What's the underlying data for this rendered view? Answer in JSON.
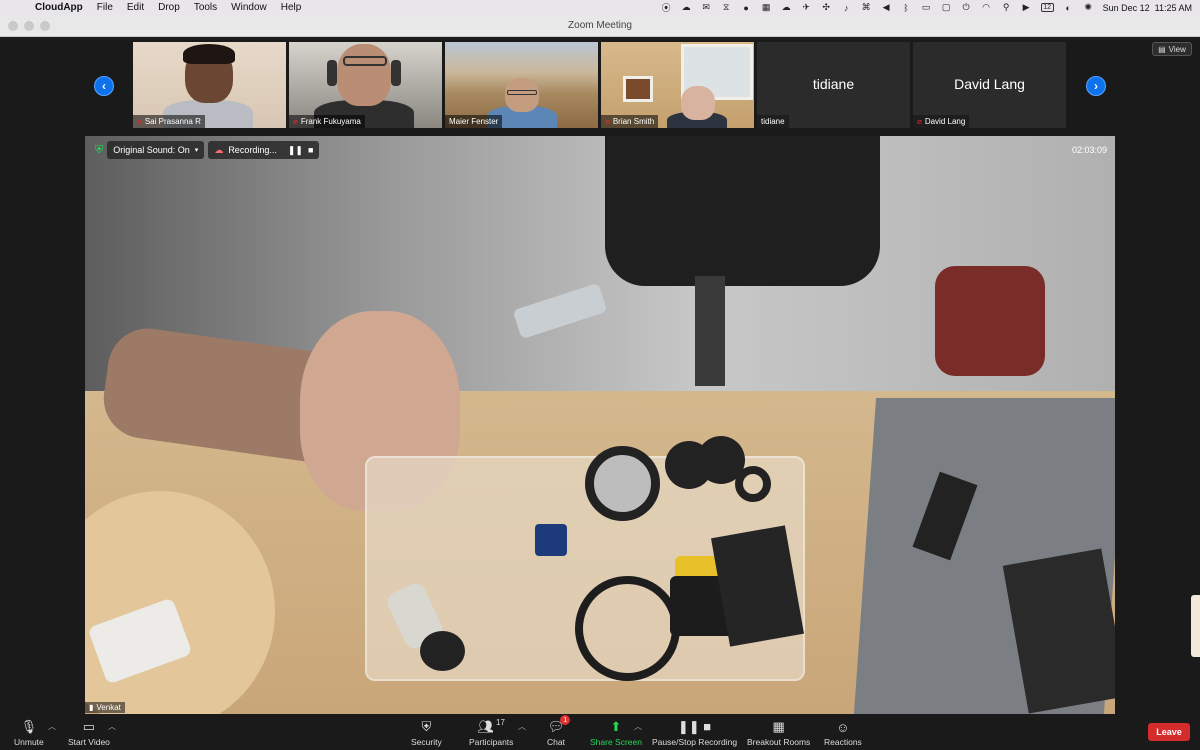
{
  "menubar": {
    "app_name": "CloudApp",
    "items": [
      "File",
      "Edit",
      "Drop",
      "Tools",
      "Window",
      "Help"
    ],
    "status_icons": [
      "record-icon",
      "cloud-icon",
      "mail-icon",
      "diff-icon",
      "dot-icon",
      "grid-icon",
      "cloud-alt-icon",
      "bird-icon",
      "fan-icon",
      "mic-icon",
      "keys-icon",
      "volume-icon",
      "bluetooth-icon",
      "battery-icon",
      "display-icon",
      "power-icon",
      "wifi-icon",
      "search-icon",
      "play-icon",
      "calendar-icon",
      "toggle-icon",
      "siri-icon"
    ],
    "calendar_day": "12",
    "datetime": "Sun Dec 12  11:25 AM"
  },
  "window": {
    "title": "Zoom Meeting"
  },
  "gallery": {
    "view_label": "View",
    "participants": [
      {
        "name": "Sai Prasanna R",
        "muted": true
      },
      {
        "name": "Frank Fukuyama",
        "muted": true
      },
      {
        "name": "Maier Fenster",
        "muted": false
      },
      {
        "name": "Brian Smith",
        "muted": true
      },
      {
        "name": "tidiane",
        "muted": false,
        "big_name": "tidiane"
      },
      {
        "name": "David Lang",
        "muted": true,
        "big_name": "David Lang"
      }
    ]
  },
  "main": {
    "original_sound": "Original Sound: On",
    "recording": "Recording...",
    "timer": "02:03:09",
    "speaker": "Venkat"
  },
  "toolbar": {
    "unmute": "Unmute",
    "start_video": "Start Video",
    "security": "Security",
    "participants": "Participants",
    "participants_count": "17",
    "chat": "Chat",
    "chat_badge": "1",
    "share_screen": "Share Screen",
    "recording": "Pause/Stop Recording",
    "breakout": "Breakout Rooms",
    "reactions": "Reactions",
    "leave": "Leave"
  },
  "colors": {
    "accent": "#0e72ed",
    "leave": "#d42b2b",
    "share": "#23d959",
    "mute": "#e02828"
  }
}
